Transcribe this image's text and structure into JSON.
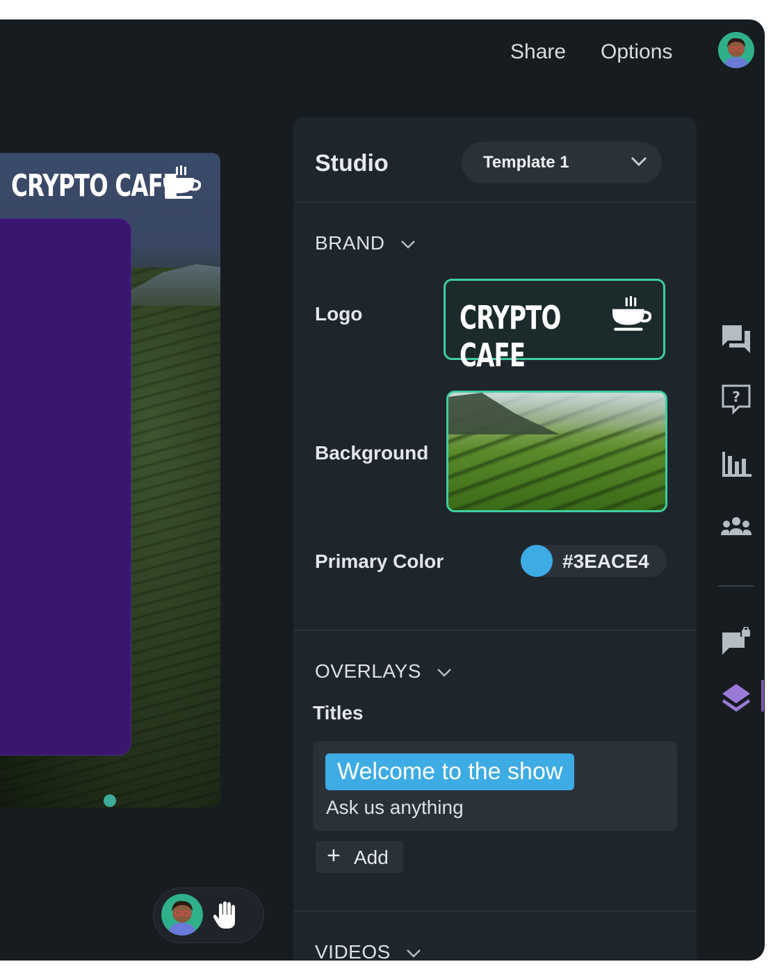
{
  "topbar": {
    "share_label": "Share",
    "options_label": "Options"
  },
  "stage": {
    "title": "CRYPTO CAFE"
  },
  "studio": {
    "title": "Studio",
    "template_select": "Template 1",
    "brand": {
      "heading": "BRAND",
      "logo_label": "Logo",
      "logo_text": "CRYPTO CAFE",
      "background_label": "Background",
      "primary_color_label": "Primary Color",
      "primary_color_value": "#3EACE4"
    },
    "overlays": {
      "heading": "OVERLAYS",
      "titles_label": "Titles",
      "title_main": "Welcome to the show",
      "title_sub": "Ask us anything",
      "add_label": "Add"
    },
    "videos": {
      "heading": "VIDEOS"
    }
  },
  "rail": {
    "icons": [
      "chat-icon",
      "question-icon",
      "bar-chart-icon",
      "people-icon",
      "pinned-message-icon",
      "layers-icon"
    ]
  },
  "colors": {
    "accent_teal": "#3ecfa0",
    "primary": "#3EACE4",
    "stage_card": "#3a1670"
  }
}
